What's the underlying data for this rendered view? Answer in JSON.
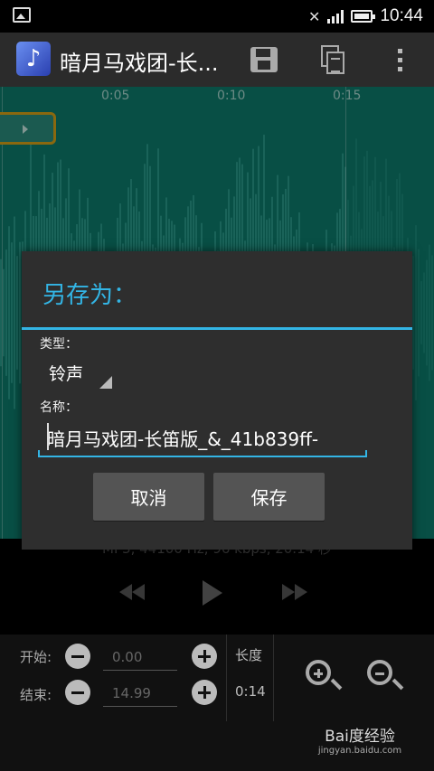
{
  "status_bar": {
    "time": "10:44"
  },
  "app": {
    "title": "暗月马戏团-长...",
    "icon_glyph": "♪"
  },
  "toolbar": {
    "icons": [
      "save-icon",
      "copy-icon",
      "overflow-menu-icon"
    ]
  },
  "waveform": {
    "ticks": [
      "0:05",
      "0:10",
      "0:15"
    ],
    "color": "#0d7a6b"
  },
  "file_info": "MP3, 44100 Hz, 96 kbps, 20.14 秒",
  "edit": {
    "start_label": "开始:",
    "end_label": "结束:",
    "start_value": "0.00",
    "end_value": "14.99",
    "length_label": "长度",
    "length_value": "0:14"
  },
  "dialog": {
    "title": "另存为：",
    "type_label": "类型：",
    "type_value": "铃声",
    "name_label": "名称：",
    "name_value": "暗月马戏团-长笛版_&_41b839ff-",
    "cancel_label": "取消",
    "save_label": "保存",
    "accent": "#33b5e5"
  },
  "watermark": {
    "main": "Bai度经验",
    "sub": "jingyan.baidu.com"
  }
}
